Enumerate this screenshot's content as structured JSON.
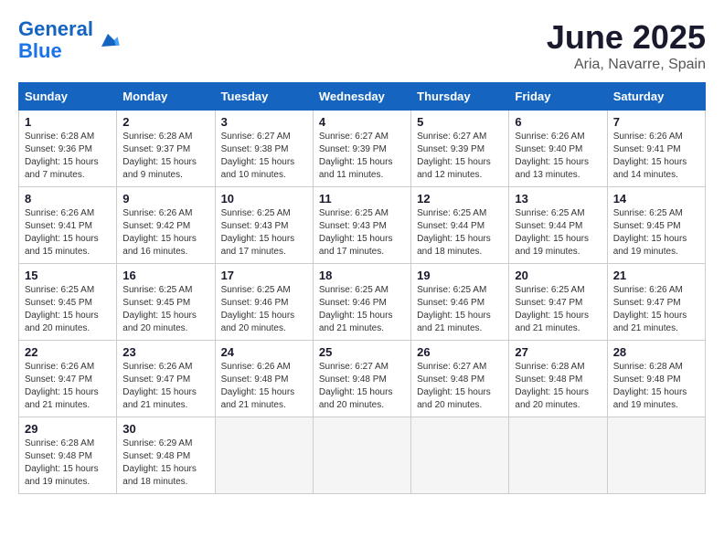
{
  "header": {
    "logo_line1": "General",
    "logo_line2": "Blue",
    "month": "June 2025",
    "location": "Aria, Navarre, Spain"
  },
  "weekdays": [
    "Sunday",
    "Monday",
    "Tuesday",
    "Wednesday",
    "Thursday",
    "Friday",
    "Saturday"
  ],
  "weeks": [
    [
      {
        "day": "1",
        "sunrise": "6:28 AM",
        "sunset": "9:36 PM",
        "daylight": "15 hours and 7 minutes."
      },
      {
        "day": "2",
        "sunrise": "6:28 AM",
        "sunset": "9:37 PM",
        "daylight": "15 hours and 9 minutes."
      },
      {
        "day": "3",
        "sunrise": "6:27 AM",
        "sunset": "9:38 PM",
        "daylight": "15 hours and 10 minutes."
      },
      {
        "day": "4",
        "sunrise": "6:27 AM",
        "sunset": "9:39 PM",
        "daylight": "15 hours and 11 minutes."
      },
      {
        "day": "5",
        "sunrise": "6:27 AM",
        "sunset": "9:39 PM",
        "daylight": "15 hours and 12 minutes."
      },
      {
        "day": "6",
        "sunrise": "6:26 AM",
        "sunset": "9:40 PM",
        "daylight": "15 hours and 13 minutes."
      },
      {
        "day": "7",
        "sunrise": "6:26 AM",
        "sunset": "9:41 PM",
        "daylight": "15 hours and 14 minutes."
      }
    ],
    [
      {
        "day": "8",
        "sunrise": "6:26 AM",
        "sunset": "9:41 PM",
        "daylight": "15 hours and 15 minutes."
      },
      {
        "day": "9",
        "sunrise": "6:26 AM",
        "sunset": "9:42 PM",
        "daylight": "15 hours and 16 minutes."
      },
      {
        "day": "10",
        "sunrise": "6:25 AM",
        "sunset": "9:43 PM",
        "daylight": "15 hours and 17 minutes."
      },
      {
        "day": "11",
        "sunrise": "6:25 AM",
        "sunset": "9:43 PM",
        "daylight": "15 hours and 17 minutes."
      },
      {
        "day": "12",
        "sunrise": "6:25 AM",
        "sunset": "9:44 PM",
        "daylight": "15 hours and 18 minutes."
      },
      {
        "day": "13",
        "sunrise": "6:25 AM",
        "sunset": "9:44 PM",
        "daylight": "15 hours and 19 minutes."
      },
      {
        "day": "14",
        "sunrise": "6:25 AM",
        "sunset": "9:45 PM",
        "daylight": "15 hours and 19 minutes."
      }
    ],
    [
      {
        "day": "15",
        "sunrise": "6:25 AM",
        "sunset": "9:45 PM",
        "daylight": "15 hours and 20 minutes."
      },
      {
        "day": "16",
        "sunrise": "6:25 AM",
        "sunset": "9:45 PM",
        "daylight": "15 hours and 20 minutes."
      },
      {
        "day": "17",
        "sunrise": "6:25 AM",
        "sunset": "9:46 PM",
        "daylight": "15 hours and 20 minutes."
      },
      {
        "day": "18",
        "sunrise": "6:25 AM",
        "sunset": "9:46 PM",
        "daylight": "15 hours and 21 minutes."
      },
      {
        "day": "19",
        "sunrise": "6:25 AM",
        "sunset": "9:46 PM",
        "daylight": "15 hours and 21 minutes."
      },
      {
        "day": "20",
        "sunrise": "6:25 AM",
        "sunset": "9:47 PM",
        "daylight": "15 hours and 21 minutes."
      },
      {
        "day": "21",
        "sunrise": "6:26 AM",
        "sunset": "9:47 PM",
        "daylight": "15 hours and 21 minutes."
      }
    ],
    [
      {
        "day": "22",
        "sunrise": "6:26 AM",
        "sunset": "9:47 PM",
        "daylight": "15 hours and 21 minutes."
      },
      {
        "day": "23",
        "sunrise": "6:26 AM",
        "sunset": "9:47 PM",
        "daylight": "15 hours and 21 minutes."
      },
      {
        "day": "24",
        "sunrise": "6:26 AM",
        "sunset": "9:48 PM",
        "daylight": "15 hours and 21 minutes."
      },
      {
        "day": "25",
        "sunrise": "6:27 AM",
        "sunset": "9:48 PM",
        "daylight": "15 hours and 20 minutes."
      },
      {
        "day": "26",
        "sunrise": "6:27 AM",
        "sunset": "9:48 PM",
        "daylight": "15 hours and 20 minutes."
      },
      {
        "day": "27",
        "sunrise": "6:28 AM",
        "sunset": "9:48 PM",
        "daylight": "15 hours and 20 minutes."
      },
      {
        "day": "28",
        "sunrise": "6:28 AM",
        "sunset": "9:48 PM",
        "daylight": "15 hours and 19 minutes."
      }
    ],
    [
      {
        "day": "29",
        "sunrise": "6:28 AM",
        "sunset": "9:48 PM",
        "daylight": "15 hours and 19 minutes."
      },
      {
        "day": "30",
        "sunrise": "6:29 AM",
        "sunset": "9:48 PM",
        "daylight": "15 hours and 18 minutes."
      },
      null,
      null,
      null,
      null,
      null
    ]
  ]
}
